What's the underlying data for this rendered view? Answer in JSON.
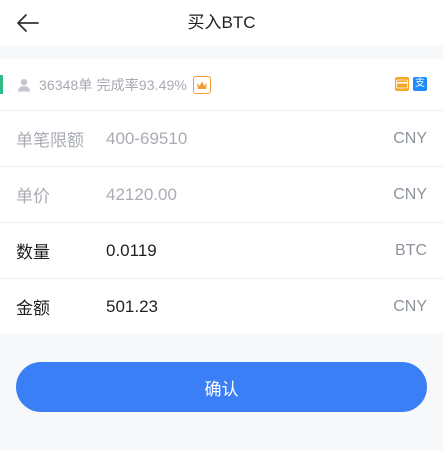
{
  "header": {
    "title": "买入BTC"
  },
  "merchant": {
    "stats": "36348单 完成率93.49%",
    "crown_icon": "crown-icon",
    "payment_icons": [
      "bank-card-icon",
      "alipay-icon"
    ],
    "alipay_glyph": "支",
    "accent_color": "#2ebd85"
  },
  "rows": [
    {
      "label": "单笔限额",
      "value": "400-69510",
      "unit": "CNY"
    },
    {
      "label": "单价",
      "value": "42120.00",
      "unit": "CNY"
    },
    {
      "label": "数量",
      "value": "0.0119",
      "unit": "BTC"
    },
    {
      "label": "金额",
      "value": "501.23",
      "unit": "CNY"
    }
  ],
  "confirm": {
    "label": "确认",
    "color": "#3a7ff6"
  }
}
